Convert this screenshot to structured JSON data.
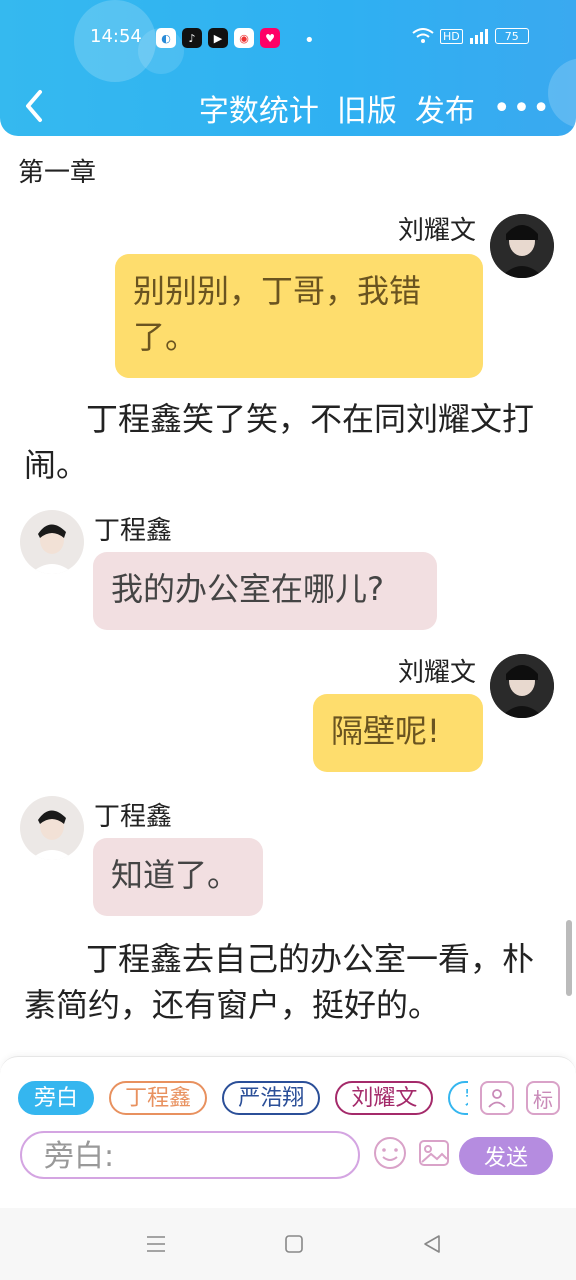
{
  "status_bar": {
    "time": "14:54",
    "battery": "75"
  },
  "header": {
    "word_count": "字数统计",
    "old_version": "旧版",
    "publish": "发布",
    "more": "•••"
  },
  "chapter_title": "第一章",
  "messages": [
    {
      "side": "right",
      "speaker": "刘耀文",
      "text": "别别别，丁哥，我错了。"
    },
    {
      "narration": "丁程鑫笑了笑，不在同刘耀文打闹。"
    },
    {
      "side": "left",
      "speaker": "丁程鑫",
      "text": "我的办公室在哪儿?"
    },
    {
      "side": "right",
      "speaker": "刘耀文",
      "text": "隔壁呢!"
    },
    {
      "side": "left",
      "speaker": "丁程鑫",
      "text": "知道了。"
    },
    {
      "narration": "丁程鑫去自己的办公室一看，朴素简约，还有窗户，挺好的。"
    }
  ],
  "role_chips": [
    "旁白",
    "丁程鑫",
    "严浩翔",
    "刘耀文",
    "宋"
  ],
  "tools": {
    "avatar_icon": "person-card-icon",
    "tag_label": "标"
  },
  "composer": {
    "placeholder": "旁白:",
    "send_label": "发送"
  },
  "colors": {
    "header": "#35b9ef",
    "yellow_bubble": "#fedd6d",
    "pink_bubble": "#f2dfe1",
    "send": "#b58ce0"
  }
}
